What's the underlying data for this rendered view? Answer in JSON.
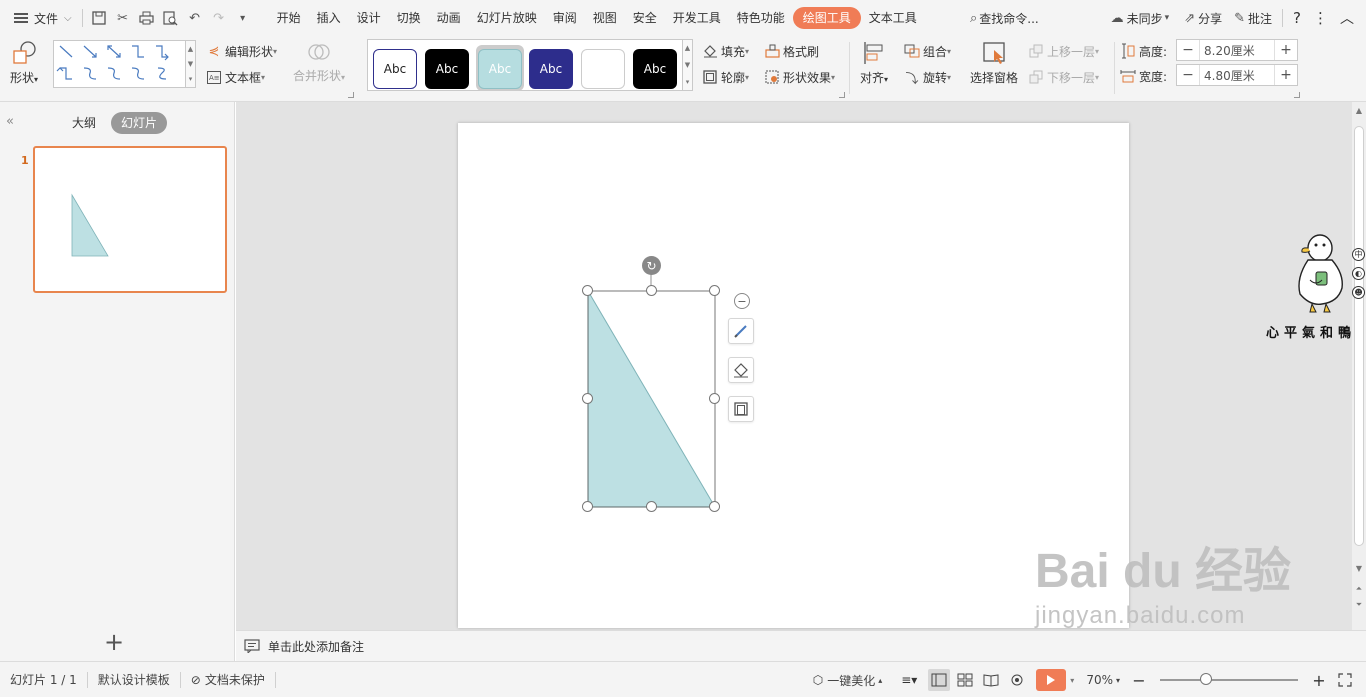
{
  "menubar": {
    "file_label": "文件",
    "tabs": [
      "开始",
      "插入",
      "设计",
      "切换",
      "动画",
      "幻灯片放映",
      "审阅",
      "视图",
      "安全",
      "开发工具",
      "特色功能",
      "绘图工具",
      "文本工具"
    ],
    "active_tab": "绘图工具",
    "search_label": "查找命令...",
    "sync_label": "未同步",
    "share_label": "分享",
    "comment_label": "批注"
  },
  "ribbon": {
    "shape_label": "形状",
    "edit_shape_label": "编辑形状",
    "textbox_label": "文本框",
    "merge_shape_label": "合并形状",
    "style_sample": "Abc",
    "fill_label": "填充",
    "format_painter_label": "格式刷",
    "outline_label": "轮廓",
    "shape_effects_label": "形状效果",
    "align_label": "对齐",
    "group_label": "组合",
    "rotate_label": "旋转",
    "selection_pane_label": "选择窗格",
    "bring_forward_label": "上移一层",
    "send_backward_label": "下移一层",
    "height_label": "高度:",
    "height_value": "8.20厘米",
    "width_label": "宽度:",
    "width_value": "4.80厘米"
  },
  "left_panel": {
    "outline_tab": "大纲",
    "slides_tab": "幻灯片",
    "slide_number": "1"
  },
  "notes": {
    "placeholder": "单击此处添加备注"
  },
  "statusbar": {
    "slide_info": "幻灯片 1 / 1",
    "template": "默认设计模板",
    "protection": "文档未保护",
    "beautify": "一键美化",
    "zoom": "70%"
  },
  "mascot": {
    "caption": "心平氣和鴨"
  },
  "watermark": {
    "brand": "Bai du 经验",
    "url": "jingyan.baidu.com"
  },
  "colors": {
    "accent": "#f07c56",
    "triangle_fill": "#bde0e3",
    "triangle_stroke": "#7fb3b8",
    "thumb_border": "#e8854d"
  }
}
